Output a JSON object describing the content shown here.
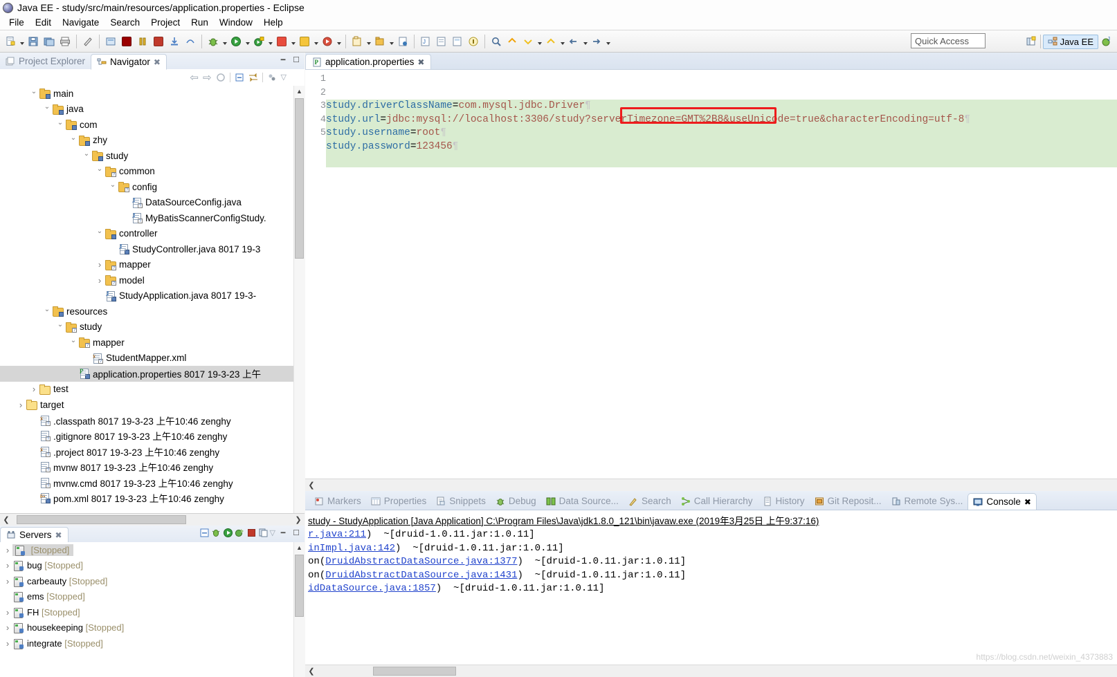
{
  "window": {
    "title": "Java EE - study/src/main/resources/application.properties - Eclipse",
    "icon": "eclipse-icon"
  },
  "menubar": [
    {
      "label": "File"
    },
    {
      "label": "Edit"
    },
    {
      "label": "Navigate"
    },
    {
      "label": "Search"
    },
    {
      "label": "Project"
    },
    {
      "label": "Run"
    },
    {
      "label": "Window"
    },
    {
      "label": "Help"
    }
  ],
  "toolbar": {
    "quick_access_placeholder": "Quick Access",
    "perspective_label": "Java EE"
  },
  "navigator_view": {
    "tabs": [
      {
        "label": "Project Explorer",
        "active": false,
        "icon": "project-explorer-icon"
      },
      {
        "label": "Navigator",
        "active": true,
        "icon": "navigator-icon"
      }
    ],
    "tree": [
      {
        "indent": 2,
        "twisty": "open",
        "icon": "package-folder",
        "label": "main",
        "selected": false
      },
      {
        "indent": 3,
        "twisty": "open",
        "icon": "package-folder",
        "label": "java",
        "selected": false
      },
      {
        "indent": 4,
        "twisty": "open",
        "icon": "package-folder",
        "label": "com",
        "selected": false
      },
      {
        "indent": 5,
        "twisty": "open",
        "icon": "package-folder",
        "label": "zhy",
        "selected": false
      },
      {
        "indent": 6,
        "twisty": "open",
        "icon": "package-folder",
        "label": "study",
        "selected": false
      },
      {
        "indent": 7,
        "twisty": "open",
        "icon": "package-folder-q",
        "label": "common",
        "selected": false
      },
      {
        "indent": 8,
        "twisty": "open",
        "icon": "package-folder-q",
        "label": "config",
        "selected": false
      },
      {
        "indent": 9,
        "twisty": "none",
        "icon": "java-file-q",
        "label": "DataSourceConfig.java",
        "selected": false
      },
      {
        "indent": 9,
        "twisty": "none",
        "icon": "java-file-q",
        "label": "MyBatisScannerConfigStudy.",
        "selected": false
      },
      {
        "indent": 7,
        "twisty": "open",
        "icon": "package-folder",
        "label": "controller",
        "selected": false
      },
      {
        "indent": 8,
        "twisty": "none",
        "icon": "java-file",
        "label": "StudyController.java 8017  19-3",
        "selected": false
      },
      {
        "indent": 7,
        "twisty": "closed",
        "icon": "package-folder-q",
        "label": "mapper",
        "selected": false
      },
      {
        "indent": 7,
        "twisty": "closed",
        "icon": "package-folder-q",
        "label": "model",
        "selected": false
      },
      {
        "indent": 7,
        "twisty": "none",
        "icon": "java-file",
        "label": "StudyApplication.java 8017  19-3-",
        "selected": false
      },
      {
        "indent": 3,
        "twisty": "open",
        "icon": "package-folder",
        "label": "resources",
        "selected": false
      },
      {
        "indent": 4,
        "twisty": "open",
        "icon": "package-folder-q",
        "label": "study",
        "selected": false
      },
      {
        "indent": 5,
        "twisty": "open",
        "icon": "package-folder-q",
        "label": "mapper",
        "selected": false
      },
      {
        "indent": 6,
        "twisty": "none",
        "icon": "xml-file",
        "label": "StudentMapper.xml",
        "selected": false
      },
      {
        "indent": 5,
        "twisty": "none",
        "icon": "properties-file",
        "label": "application.properties 8017  19-3-23 上午",
        "selected": true
      },
      {
        "indent": 2,
        "twisty": "closed",
        "icon": "folder-plain",
        "label": "test",
        "selected": false
      },
      {
        "indent": 1,
        "twisty": "closed",
        "icon": "folder-plain",
        "label": "target",
        "selected": false
      },
      {
        "indent": 2,
        "twisty": "none",
        "icon": "xml-file",
        "label": ".classpath 8017  19-3-23 上午10:46  zenghy",
        "selected": false
      },
      {
        "indent": 2,
        "twisty": "none",
        "icon": "text-file",
        "label": ".gitignore 8017  19-3-23 上午10:46  zenghy",
        "selected": false
      },
      {
        "indent": 2,
        "twisty": "none",
        "icon": "xml-file",
        "label": ".project 8017  19-3-23 上午10:46  zenghy",
        "selected": false
      },
      {
        "indent": 2,
        "twisty": "none",
        "icon": "text-file",
        "label": "mvnw 8017  19-3-23 上午10:46  zenghy",
        "selected": false
      },
      {
        "indent": 2,
        "twisty": "none",
        "icon": "text-file",
        "label": "mvnw.cmd 8017  19-3-23 上午10:46  zenghy",
        "selected": false
      },
      {
        "indent": 2,
        "twisty": "none",
        "icon": "maven-file",
        "label": "pom.xml 8017  19-3-23 上午10:46  zenghy",
        "selected": false
      }
    ]
  },
  "servers_view": {
    "tab_label": "Servers",
    "tab_icon": "servers-icon",
    "rows": [
      {
        "twisty": "closed",
        "name": "",
        "status": "[Stopped]",
        "selected": true
      },
      {
        "twisty": "closed",
        "name": "bug",
        "status": "[Stopped]",
        "selected": false
      },
      {
        "twisty": "closed",
        "name": "carbeauty",
        "status": "[Stopped]",
        "selected": false
      },
      {
        "twisty": "none",
        "name": "ems",
        "status": "[Stopped]",
        "selected": false
      },
      {
        "twisty": "closed",
        "name": "FH",
        "status": "[Stopped]",
        "selected": false
      },
      {
        "twisty": "closed",
        "name": "housekeeping",
        "status": "[Stopped]",
        "selected": false
      },
      {
        "twisty": "closed",
        "name": "integrate",
        "status": "[Stopped]",
        "selected": false
      }
    ]
  },
  "editor": {
    "tab_label": "application.properties",
    "tab_icon": "properties-file-icon",
    "line_numbers": [
      "1",
      "2",
      "3",
      "4",
      "5"
    ],
    "lines": [
      {
        "key": "study.driverClassName",
        "value": "com.mysql.jdbc.Driver"
      },
      {
        "key": "study.url",
        "value": "jdbc:mysql://localhost:3306/study?serverTimezone=GMT%2B8&useUnicode=true&characterEncoding=utf-8"
      },
      {
        "key": "study.username",
        "value": "root"
      },
      {
        "key": "study.password",
        "value": "123456"
      }
    ],
    "highlight_annotation": "serverTimezone=GMT%2B8&",
    "highlight_color": "#ee1c1c"
  },
  "bottom_panel": {
    "tabs": [
      {
        "label": "Markers",
        "icon": "markers-icon",
        "active": false
      },
      {
        "label": "Properties",
        "icon": "properties-icon",
        "active": false
      },
      {
        "label": "Snippets",
        "icon": "snippets-icon",
        "active": false
      },
      {
        "label": "Debug",
        "icon": "debug-icon",
        "active": false
      },
      {
        "label": "Data Source...",
        "icon": "data-source-icon",
        "active": false
      },
      {
        "label": "Search",
        "icon": "search-icon",
        "active": false
      },
      {
        "label": "Call Hierarchy",
        "icon": "call-hierarchy-icon",
        "active": false
      },
      {
        "label": "History",
        "icon": "history-icon",
        "active": false
      },
      {
        "label": "Git Reposit...",
        "icon": "git-repository-icon",
        "active": false
      },
      {
        "label": "Remote Sys...",
        "icon": "remote-systems-icon",
        "active": false
      },
      {
        "label": "Console",
        "icon": "console-icon",
        "active": true
      }
    ],
    "console": {
      "header": "study - StudyApplication [Java Application] C:\\Program Files\\Java\\jdk1.8.0_121\\bin\\javaw.exe (2019年3月25日 上午9:37:16)",
      "lines": [
        {
          "link": "r.java:211",
          "prefix": "",
          "suffix": ")  ~[druid-1.0.11.jar:1.0.11]"
        },
        {
          "link": "inImpl.java:142",
          "prefix": "",
          "suffix": ")  ~[druid-1.0.11.jar:1.0.11]"
        },
        {
          "link": "DruidAbstractDataSource.java:1377",
          "prefix": "on(",
          "suffix": ")  ~[druid-1.0.11.jar:1.0.11]"
        },
        {
          "link": "DruidAbstractDataSource.java:1431",
          "prefix": "on(",
          "suffix": ")  ~[druid-1.0.11.jar:1.0.11]"
        },
        {
          "link": "idDataSource.java:1857",
          "prefix": "",
          "suffix": ")  ~[druid-1.0.11.jar:1.0.11]"
        }
      ]
    }
  },
  "watermark": "https://blog.csdn.net/weixin_4373883"
}
